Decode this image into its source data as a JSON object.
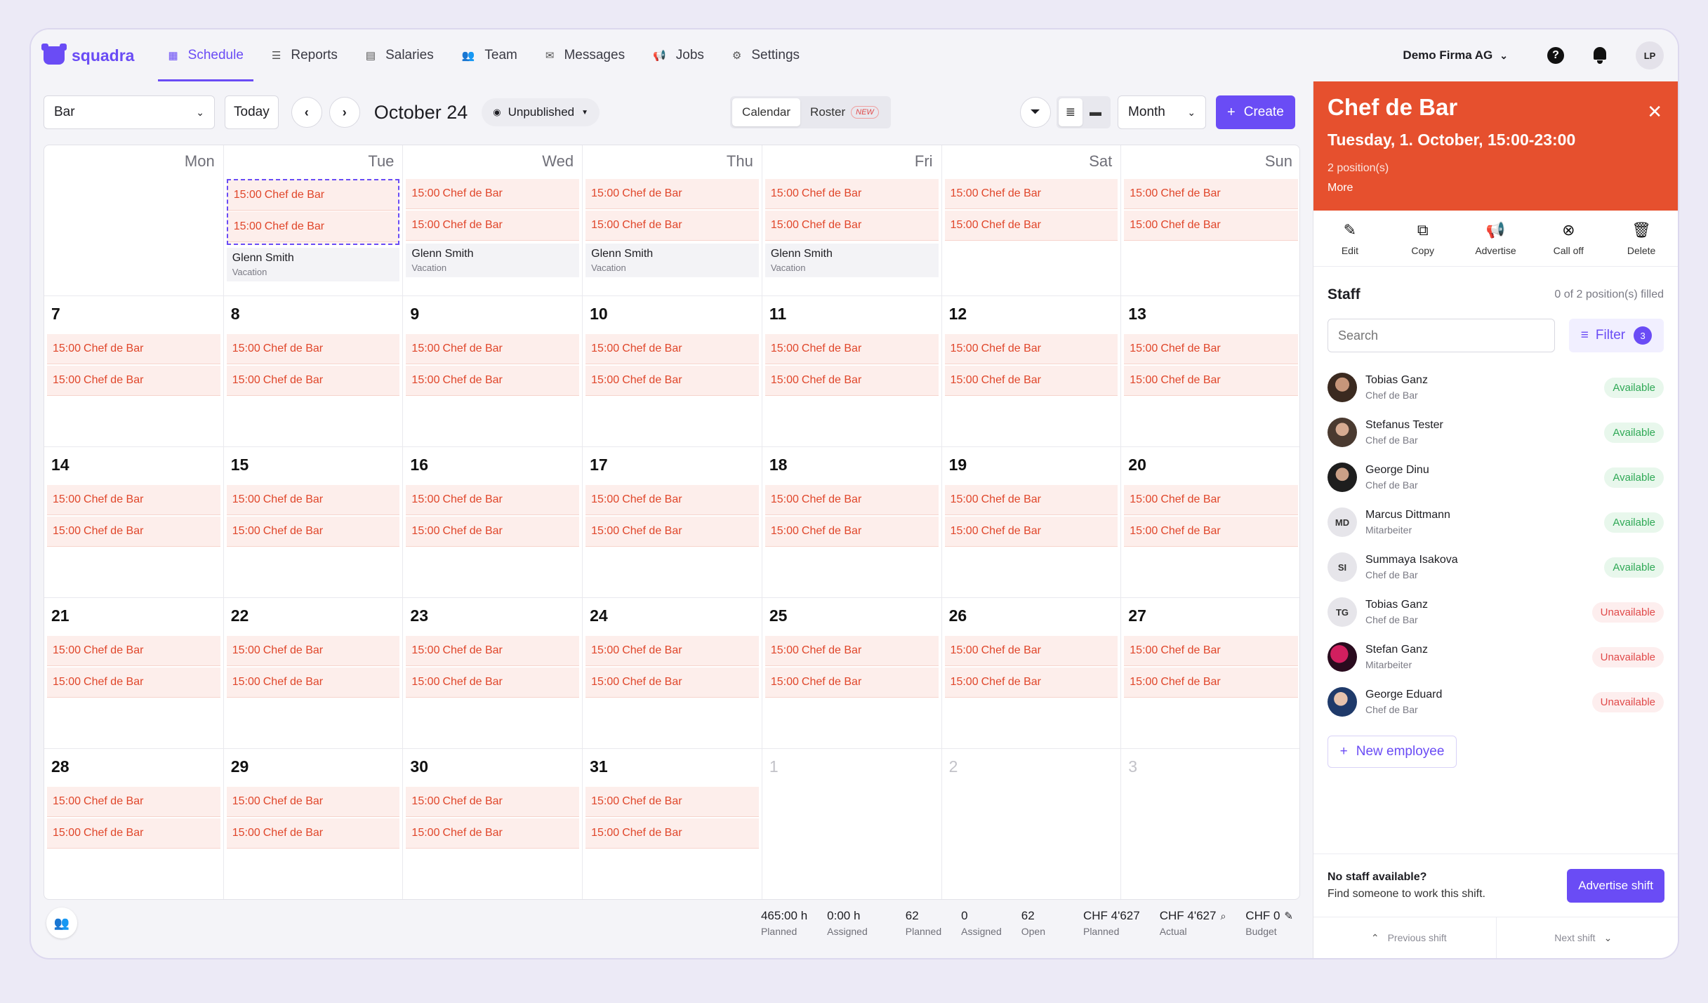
{
  "brand": {
    "name": "squadra",
    "accent": "#6a4cf5",
    "shift_color": "#e0462a",
    "header_color": "#e6502e"
  },
  "nav": [
    {
      "label": "Schedule",
      "icon": "calendar-icon",
      "glyph": "▦",
      "active": true
    },
    {
      "label": "Reports",
      "icon": "list-icon",
      "glyph": "☰",
      "active": false
    },
    {
      "label": "Salaries",
      "icon": "table-icon",
      "glyph": "▤",
      "active": false
    },
    {
      "label": "Team",
      "icon": "people-icon",
      "glyph": "👥",
      "active": false
    },
    {
      "label": "Messages",
      "icon": "mail-icon",
      "glyph": "✉",
      "active": false
    },
    {
      "label": "Jobs",
      "icon": "megaphone-icon",
      "glyph": "📢",
      "active": false
    },
    {
      "label": "Settings",
      "icon": "gear-icon",
      "glyph": "⚙",
      "active": false
    }
  ],
  "user": {
    "company": "Demo Firma AG",
    "initials": "LP"
  },
  "toolbar": {
    "location": "Bar",
    "today_label": "Today",
    "month_title": "October 24",
    "publish_filter": "Unpublished",
    "view_calendar": "Calendar",
    "view_roster": "Roster",
    "new_badge": "NEW",
    "period": "Month",
    "create_label": "Create"
  },
  "calendar": {
    "weekdays": [
      "Mon",
      "Tue",
      "Wed",
      "Thu",
      "Fri",
      "Sat",
      "Sun"
    ],
    "shift_time": "15:00",
    "shift_name": "Chef de Bar",
    "weeks": [
      [
        {
          "day": "",
          "shifts": 0
        },
        {
          "day": "",
          "shifts": 2,
          "selected": true,
          "vacation": {
            "name": "Glenn Smith",
            "type": "Vacation"
          }
        },
        {
          "day": "",
          "shifts": 2,
          "vacation": {
            "name": "Glenn Smith",
            "type": "Vacation"
          }
        },
        {
          "day": "",
          "shifts": 2,
          "vacation": {
            "name": "Glenn Smith",
            "type": "Vacation"
          }
        },
        {
          "day": "",
          "shifts": 2,
          "vacation": {
            "name": "Glenn Smith",
            "type": "Vacation"
          }
        },
        {
          "day": "",
          "shifts": 2
        },
        {
          "day": "",
          "shifts": 2
        }
      ],
      [
        {
          "day": "7",
          "shifts": 2
        },
        {
          "day": "8",
          "shifts": 2
        },
        {
          "day": "9",
          "shifts": 2
        },
        {
          "day": "10",
          "shifts": 2
        },
        {
          "day": "11",
          "shifts": 2
        },
        {
          "day": "12",
          "shifts": 2
        },
        {
          "day": "13",
          "shifts": 2
        }
      ],
      [
        {
          "day": "14",
          "shifts": 2
        },
        {
          "day": "15",
          "shifts": 2
        },
        {
          "day": "16",
          "shifts": 2
        },
        {
          "day": "17",
          "shifts": 2
        },
        {
          "day": "18",
          "shifts": 2
        },
        {
          "day": "19",
          "shifts": 2
        },
        {
          "day": "20",
          "shifts": 2
        }
      ],
      [
        {
          "day": "21",
          "shifts": 2
        },
        {
          "day": "22",
          "shifts": 2
        },
        {
          "day": "23",
          "shifts": 2
        },
        {
          "day": "24",
          "shifts": 2
        },
        {
          "day": "25",
          "shifts": 2
        },
        {
          "day": "26",
          "shifts": 2
        },
        {
          "day": "27",
          "shifts": 2
        }
      ],
      [
        {
          "day": "28",
          "shifts": 2
        },
        {
          "day": "29",
          "shifts": 2
        },
        {
          "day": "30",
          "shifts": 2
        },
        {
          "day": "31",
          "shifts": 2
        },
        {
          "day": "1",
          "shifts": 0,
          "dim": true
        },
        {
          "day": "2",
          "shifts": 0,
          "dim": true
        },
        {
          "day": "3",
          "shifts": 0,
          "dim": true
        }
      ]
    ]
  },
  "footer": {
    "hours": [
      {
        "value": "465:00 h",
        "label": "Planned"
      },
      {
        "value": "0:00 h",
        "label": "Assigned"
      }
    ],
    "shifts": [
      {
        "value": "62",
        "label": "Planned"
      },
      {
        "value": "0",
        "label": "Assigned"
      },
      {
        "value": "62",
        "label": "Open"
      }
    ],
    "costs": [
      {
        "value": "CHF 4'627",
        "label": "Planned"
      },
      {
        "value": "CHF 4'627",
        "label": "Actual"
      },
      {
        "value": "CHF 0",
        "label": "Budget"
      }
    ]
  },
  "panel": {
    "title": "Chef de Bar",
    "subtitle": "Tuesday, 1. October, 15:00-23:00",
    "positions": "2 position(s)",
    "more": "More",
    "actions": [
      {
        "label": "Edit",
        "icon": "pencil-icon",
        "glyph": "✎"
      },
      {
        "label": "Copy",
        "icon": "copy-icon",
        "glyph": "⧉"
      },
      {
        "label": "Advertise",
        "icon": "megaphone-icon",
        "glyph": "📢"
      },
      {
        "label": "Call off",
        "icon": "cancel-circle-icon",
        "glyph": "⊗"
      },
      {
        "label": "Delete",
        "icon": "trash-icon",
        "glyph": "🗑"
      }
    ],
    "staff_title": "Staff",
    "staff_count": "0 of 2 position(s) filled",
    "search_placeholder": "Search",
    "filter_label": "Filter",
    "filter_count": "3",
    "staff": [
      {
        "name": "Tobias Ganz",
        "role": "Chef de Bar",
        "status": "Available",
        "available": true,
        "avatar": "photo1",
        "initials": ""
      },
      {
        "name": "Stefanus Tester",
        "role": "Chef de Bar",
        "status": "Available",
        "available": true,
        "avatar": "photo2",
        "initials": ""
      },
      {
        "name": "George Dinu",
        "role": "Chef de Bar",
        "status": "Available",
        "available": true,
        "avatar": "photo3",
        "initials": ""
      },
      {
        "name": "Marcus Dittmann",
        "role": "Mitarbeiter",
        "status": "Available",
        "available": true,
        "avatar": "",
        "initials": "MD"
      },
      {
        "name": "Summaya Isakova",
        "role": "Chef de Bar",
        "status": "Available",
        "available": true,
        "avatar": "",
        "initials": "SI"
      },
      {
        "name": "Tobias Ganz",
        "role": "Chef de Bar",
        "status": "Unavailable",
        "available": false,
        "avatar": "",
        "initials": "TG"
      },
      {
        "name": "Stefan Ganz",
        "role": "Mitarbeiter",
        "status": "Unavailable",
        "available": false,
        "avatar": "photo4",
        "initials": ""
      },
      {
        "name": "George Eduard",
        "role": "Chef de Bar",
        "status": "Unavailable",
        "available": false,
        "avatar": "photo5",
        "initials": ""
      }
    ],
    "new_employee": "New employee",
    "nostaff_title": "No staff available?",
    "nostaff_sub": "Find someone to work this shift.",
    "advertise_btn": "Advertise shift",
    "prev_shift": "Previous shift",
    "next_shift": "Next shift"
  }
}
